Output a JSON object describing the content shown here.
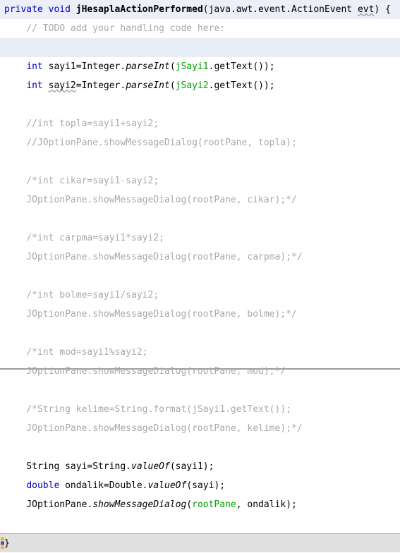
{
  "editor": {
    "language": "java",
    "font_size_px": 13,
    "line_height_px": 27,
    "colors": {
      "background": "#ffffff",
      "keyword": "#0000cc",
      "identifier_green": "#00a000",
      "comment": "#a9a9a9",
      "text": "#000000",
      "signature_line_highlight": "#eceef8",
      "caret_line_highlight": "#e7eef7",
      "fold_row_background": "#e0e0e0",
      "fold_marker": "#e8a33d",
      "bottom_rule": "#9aa0a6"
    },
    "lines": [
      {
        "id": "line-1",
        "state": "signature",
        "tokens": [
          {
            "t": "private",
            "c": "kw"
          },
          {
            "t": " ",
            "c": "plain"
          },
          {
            "t": "void",
            "c": "kw"
          },
          {
            "t": " ",
            "c": "plain"
          },
          {
            "t": "jHesaplaActionPerformed",
            "c": "decl"
          },
          {
            "t": "(java.awt.event.ActionEvent ",
            "c": "plain"
          },
          {
            "t": "evt",
            "c": "warn"
          },
          {
            "t": ") {",
            "c": "plain"
          }
        ]
      },
      {
        "id": "line-2",
        "state": "normal",
        "tokens": [
          {
            "t": "    // TODO add your handling code here:",
            "c": "cmt"
          }
        ]
      },
      {
        "id": "line-3",
        "state": "caret",
        "tokens": [
          {
            "t": "",
            "c": "plain"
          }
        ]
      },
      {
        "id": "line-4",
        "state": "normal",
        "tokens": [
          {
            "t": "    ",
            "c": "plain"
          },
          {
            "t": "int",
            "c": "kw"
          },
          {
            "t": " sayi1=Integer.",
            "c": "plain"
          },
          {
            "t": "parseInt",
            "c": "mth"
          },
          {
            "t": "(",
            "c": "plain"
          },
          {
            "t": "jSayi1",
            "c": "idg"
          },
          {
            "t": ".getText());",
            "c": "plain"
          }
        ]
      },
      {
        "id": "line-5",
        "state": "normal",
        "tokens": [
          {
            "t": "    ",
            "c": "plain"
          },
          {
            "t": "int",
            "c": "kw"
          },
          {
            "t": " ",
            "c": "plain"
          },
          {
            "t": "sayi2",
            "c": "warn"
          },
          {
            "t": "=Integer.",
            "c": "plain"
          },
          {
            "t": "parseInt",
            "c": "mth"
          },
          {
            "t": "(",
            "c": "plain"
          },
          {
            "t": "jSayi2",
            "c": "idg"
          },
          {
            "t": ".getText());",
            "c": "plain"
          }
        ]
      },
      {
        "id": "line-6",
        "state": "normal",
        "tokens": [
          {
            "t": "",
            "c": "plain"
          }
        ]
      },
      {
        "id": "line-7",
        "state": "normal",
        "tokens": [
          {
            "t": "    //int topla=sayi1+sayi2;",
            "c": "cmt"
          }
        ]
      },
      {
        "id": "line-8",
        "state": "normal",
        "tokens": [
          {
            "t": "    //JOptionPane.showMessageDialog(rootPane, topla);",
            "c": "cmt"
          }
        ]
      },
      {
        "id": "line-9",
        "state": "normal",
        "tokens": [
          {
            "t": "",
            "c": "plain"
          }
        ]
      },
      {
        "id": "line-10",
        "state": "normal",
        "tokens": [
          {
            "t": "    /*int cikar=sayi1-sayi2;",
            "c": "cmt"
          }
        ]
      },
      {
        "id": "line-11",
        "state": "normal",
        "tokens": [
          {
            "t": "    JOptionPane.showMessageDialog(rootPane, cikar);*/",
            "c": "cmt"
          }
        ]
      },
      {
        "id": "line-12",
        "state": "normal",
        "tokens": [
          {
            "t": "",
            "c": "plain"
          }
        ]
      },
      {
        "id": "line-13",
        "state": "normal",
        "tokens": [
          {
            "t": "    /*int carpma=sayi1*sayi2;",
            "c": "cmt"
          }
        ]
      },
      {
        "id": "line-14",
        "state": "normal",
        "tokens": [
          {
            "t": "    JOptionPane.showMessageDialog(rootPane, carpma);*/",
            "c": "cmt"
          }
        ]
      },
      {
        "id": "line-15",
        "state": "normal",
        "tokens": [
          {
            "t": "",
            "c": "plain"
          }
        ]
      },
      {
        "id": "line-16",
        "state": "normal",
        "tokens": [
          {
            "t": "    /*int bolme=sayi1/sayi2;",
            "c": "cmt"
          }
        ]
      },
      {
        "id": "line-17",
        "state": "normal",
        "tokens": [
          {
            "t": "    JOptionPane.showMessageDialog(rootPane, bolme);*/",
            "c": "cmt"
          }
        ]
      },
      {
        "id": "line-18",
        "state": "normal",
        "tokens": [
          {
            "t": "",
            "c": "plain"
          }
        ]
      },
      {
        "id": "line-19",
        "state": "normal",
        "tokens": [
          {
            "t": "    /*int mod=sayi1%sayi2;",
            "c": "cmt"
          }
        ]
      },
      {
        "id": "line-20",
        "state": "normal",
        "tokens": [
          {
            "t": "    JOptionPane.showMessageDialog(rootPane, mod);*/",
            "c": "cmt"
          }
        ]
      },
      {
        "id": "line-21",
        "state": "normal",
        "tokens": [
          {
            "t": "",
            "c": "plain"
          }
        ]
      },
      {
        "id": "line-22",
        "state": "normal",
        "tokens": [
          {
            "t": "    /*String kelime=String.format(jSayi1.getText());",
            "c": "cmt"
          }
        ]
      },
      {
        "id": "line-23",
        "state": "normal",
        "tokens": [
          {
            "t": "    JOptionPane.showMessageDialog(rootPane, kelime);*/",
            "c": "cmt"
          }
        ]
      },
      {
        "id": "line-24",
        "state": "normal",
        "tokens": [
          {
            "t": "",
            "c": "plain"
          }
        ]
      },
      {
        "id": "line-25",
        "state": "normal",
        "tokens": [
          {
            "t": "    String sayi=String.",
            "c": "plain"
          },
          {
            "t": "valueOf",
            "c": "mth"
          },
          {
            "t": "(sayi1);",
            "c": "plain"
          }
        ]
      },
      {
        "id": "line-26",
        "state": "normal",
        "tokens": [
          {
            "t": "    ",
            "c": "plain"
          },
          {
            "t": "double",
            "c": "kw"
          },
          {
            "t": " ondalik=Double.",
            "c": "plain"
          },
          {
            "t": "valueOf",
            "c": "mth"
          },
          {
            "t": "(sayi);",
            "c": "plain"
          }
        ]
      },
      {
        "id": "line-27",
        "state": "normal",
        "tokens": [
          {
            "t": "    JOptionPane.",
            "c": "plain"
          },
          {
            "t": "showMessageDialog",
            "c": "mth"
          },
          {
            "t": "(",
            "c": "plain"
          },
          {
            "t": "rootPane",
            "c": "idg"
          },
          {
            "t": ", ondalik);",
            "c": "plain"
          }
        ]
      },
      {
        "id": "line-28",
        "state": "normal",
        "tokens": [
          {
            "t": "",
            "c": "plain"
          }
        ]
      },
      {
        "id": "line-29",
        "state": "fold",
        "marker": "fold-marker",
        "tokens": [
          {
            "t": "}",
            "c": "plain"
          }
        ]
      }
    ]
  }
}
